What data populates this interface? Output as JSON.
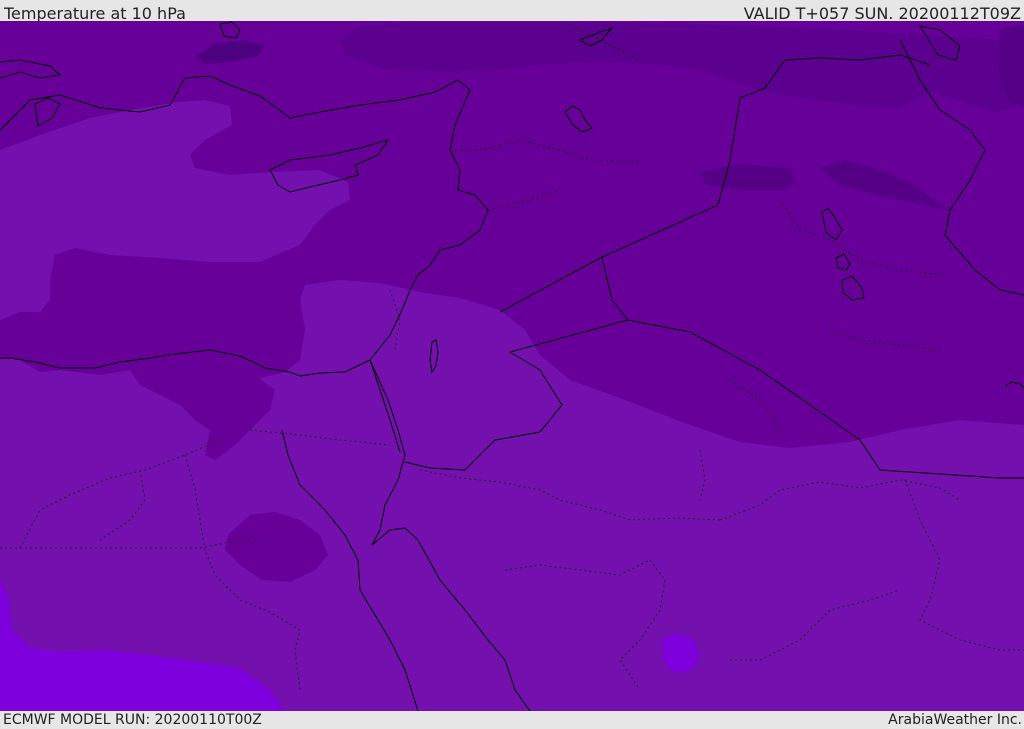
{
  "header": {
    "title": "Temperature at 10 hPa",
    "valid": "VALID T+057 SUN. 20200112T09Z"
  },
  "footer": {
    "model_run": "ECMWF MODEL RUN: 20200110T00Z",
    "credit": "ArabiaWeather Inc."
  },
  "colors": {
    "background_band": "#e6e6e6",
    "temp_darkest": "#4d0080",
    "temp_dark": "#5c0090",
    "temp_mid": "#660099",
    "temp_light": "#7310ae",
    "temp_lightest": "#7d00dd",
    "coastline": "#000000"
  }
}
